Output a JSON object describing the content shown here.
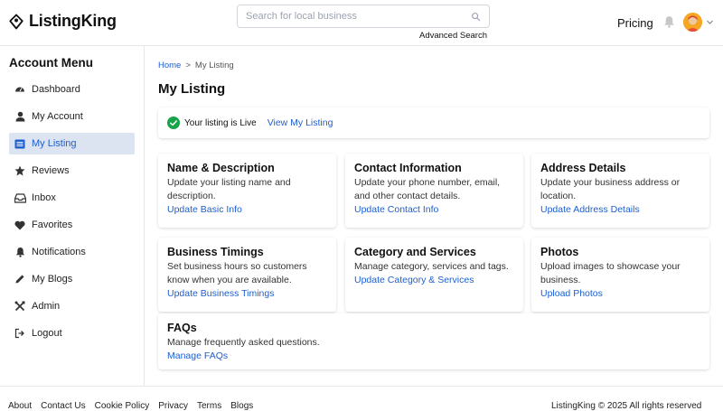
{
  "header": {
    "logo_text": "ListingKing",
    "search_placeholder": "Search for local business",
    "advanced_search": "Advanced Search",
    "pricing": "Pricing"
  },
  "sidebar": {
    "title": "Account Menu",
    "items": [
      {
        "label": "Dashboard",
        "icon": "dashboard-icon"
      },
      {
        "label": "My Account",
        "icon": "user-icon"
      },
      {
        "label": "My Listing",
        "icon": "listing-icon",
        "active": true
      },
      {
        "label": "Reviews",
        "icon": "star-icon"
      },
      {
        "label": "Inbox",
        "icon": "inbox-icon"
      },
      {
        "label": "Favorites",
        "icon": "heart-icon"
      },
      {
        "label": "Notifications",
        "icon": "bell-icon"
      },
      {
        "label": "My Blogs",
        "icon": "pen-icon"
      },
      {
        "label": "Admin",
        "icon": "tools-icon"
      },
      {
        "label": "Logout",
        "icon": "logout-icon"
      }
    ]
  },
  "breadcrumb": {
    "home": "Home",
    "separator": ">",
    "current": "My Listing"
  },
  "page_title": "My Listing",
  "status": {
    "text": "Your listing is Live",
    "link": "View My Listing"
  },
  "cards": [
    {
      "title": "Name & Description",
      "desc": "Update your listing name and description.",
      "link": "Update Basic Info"
    },
    {
      "title": "Contact Information",
      "desc": "Update your phone number, email, and other contact details.",
      "link": "Update Contact Info"
    },
    {
      "title": "Address Details",
      "desc": "Update your business address or location.",
      "link": "Update Address Details"
    },
    {
      "title": "Business Timings",
      "desc": "Set business hours so customers know when you are available.",
      "link": "Update Business Timings"
    },
    {
      "title": "Category and Services",
      "desc": "Manage category, services and tags.",
      "link": "Update Category & Services"
    },
    {
      "title": "Photos",
      "desc": "Upload images to showcase your business.",
      "link": "Upload Photos"
    },
    {
      "title": "FAQs",
      "desc": "Manage frequently asked questions.",
      "link": "Manage FAQs"
    }
  ],
  "footer": {
    "links": [
      "About",
      "Contact Us",
      "Cookie Policy",
      "Privacy",
      "Terms",
      "Blogs"
    ],
    "copyright": "ListingKing © 2025 All rights reserved"
  },
  "colors": {
    "accent": "#1d5fd0",
    "active_bg": "#dbe4f0",
    "success": "#16a34a"
  }
}
